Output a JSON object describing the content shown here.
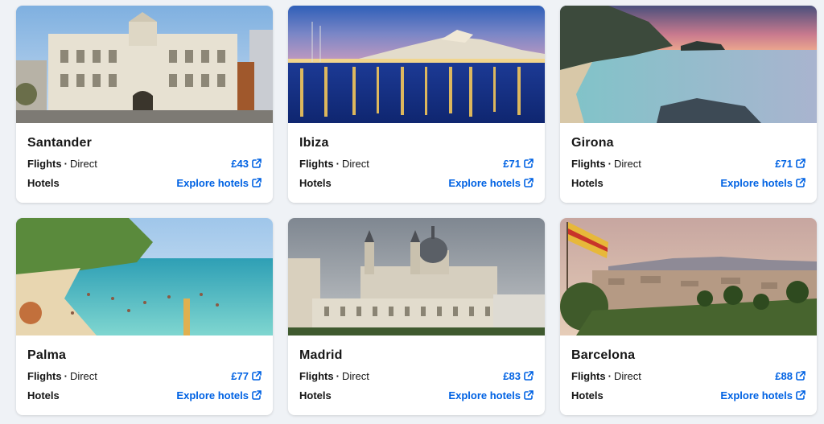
{
  "colors": {
    "accent": "#0062e3",
    "text": "#161616",
    "background": "#eff2f6",
    "card": "#ffffff"
  },
  "labels": {
    "flights": "Flights",
    "direct": "Direct",
    "hotels": "Hotels",
    "explore": "Explore hotels"
  },
  "cards": [
    {
      "city": "Santander",
      "price": "£43",
      "image": "santander-city-hall"
    },
    {
      "city": "Ibiza",
      "price": "£71",
      "image": "ibiza-harbour-night"
    },
    {
      "city": "Girona",
      "price": "£71",
      "image": "girona-coast-sunset"
    },
    {
      "city": "Palma",
      "price": "£77",
      "image": "palma-beach"
    },
    {
      "city": "Madrid",
      "price": "£83",
      "image": "madrid-cathedral"
    },
    {
      "city": "Barcelona",
      "price": "£88",
      "image": "barcelona-panorama"
    }
  ]
}
